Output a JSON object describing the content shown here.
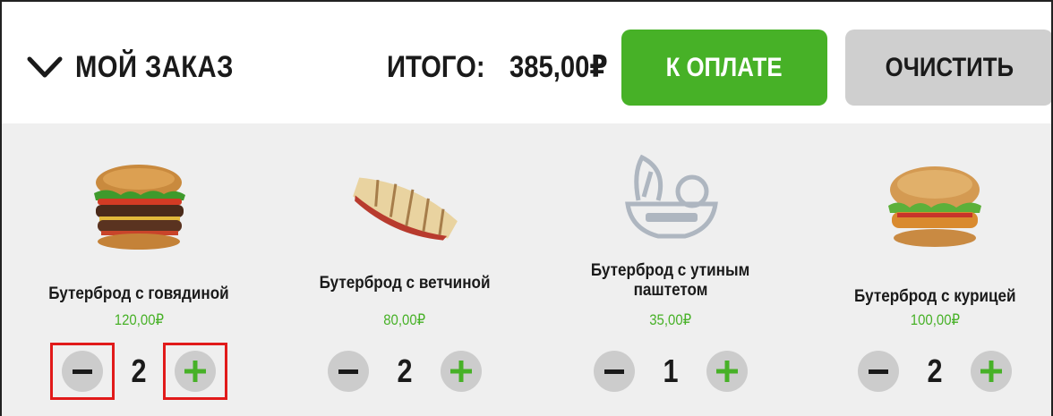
{
  "header": {
    "order_title": "МОЙ ЗАКАЗ",
    "total_label": "ИТОГО:",
    "total_value": "385,00₽",
    "pay_label": "К ОПЛАТЕ",
    "clear_label": "ОЧИСТИТЬ"
  },
  "colors": {
    "accent_green": "#47b127",
    "clear_button": "#cfcfcf",
    "highlight_red": "#e11a1a",
    "panel_bg": "#efefef"
  },
  "items": [
    {
      "name": "Бутерброд с говядиной",
      "price": "120,00₽",
      "qty": "2",
      "image": "beef-burger-image",
      "highlighted_controls": true
    },
    {
      "name": "Бутерброд с ветчиной",
      "price": "80,00₽",
      "qty": "2",
      "image": "ham-panini-image",
      "highlighted_controls": false
    },
    {
      "name_lines": [
        "Бутерброд с утиным",
        "паштетом"
      ],
      "price": "35,00₽",
      "qty": "1",
      "image": "no-image-placeholder",
      "highlighted_controls": false
    },
    {
      "name": "Бутерброд с курицей",
      "price": "100,00₽",
      "qty": "2",
      "image": "chicken-burger-image",
      "highlighted_controls": false
    }
  ]
}
